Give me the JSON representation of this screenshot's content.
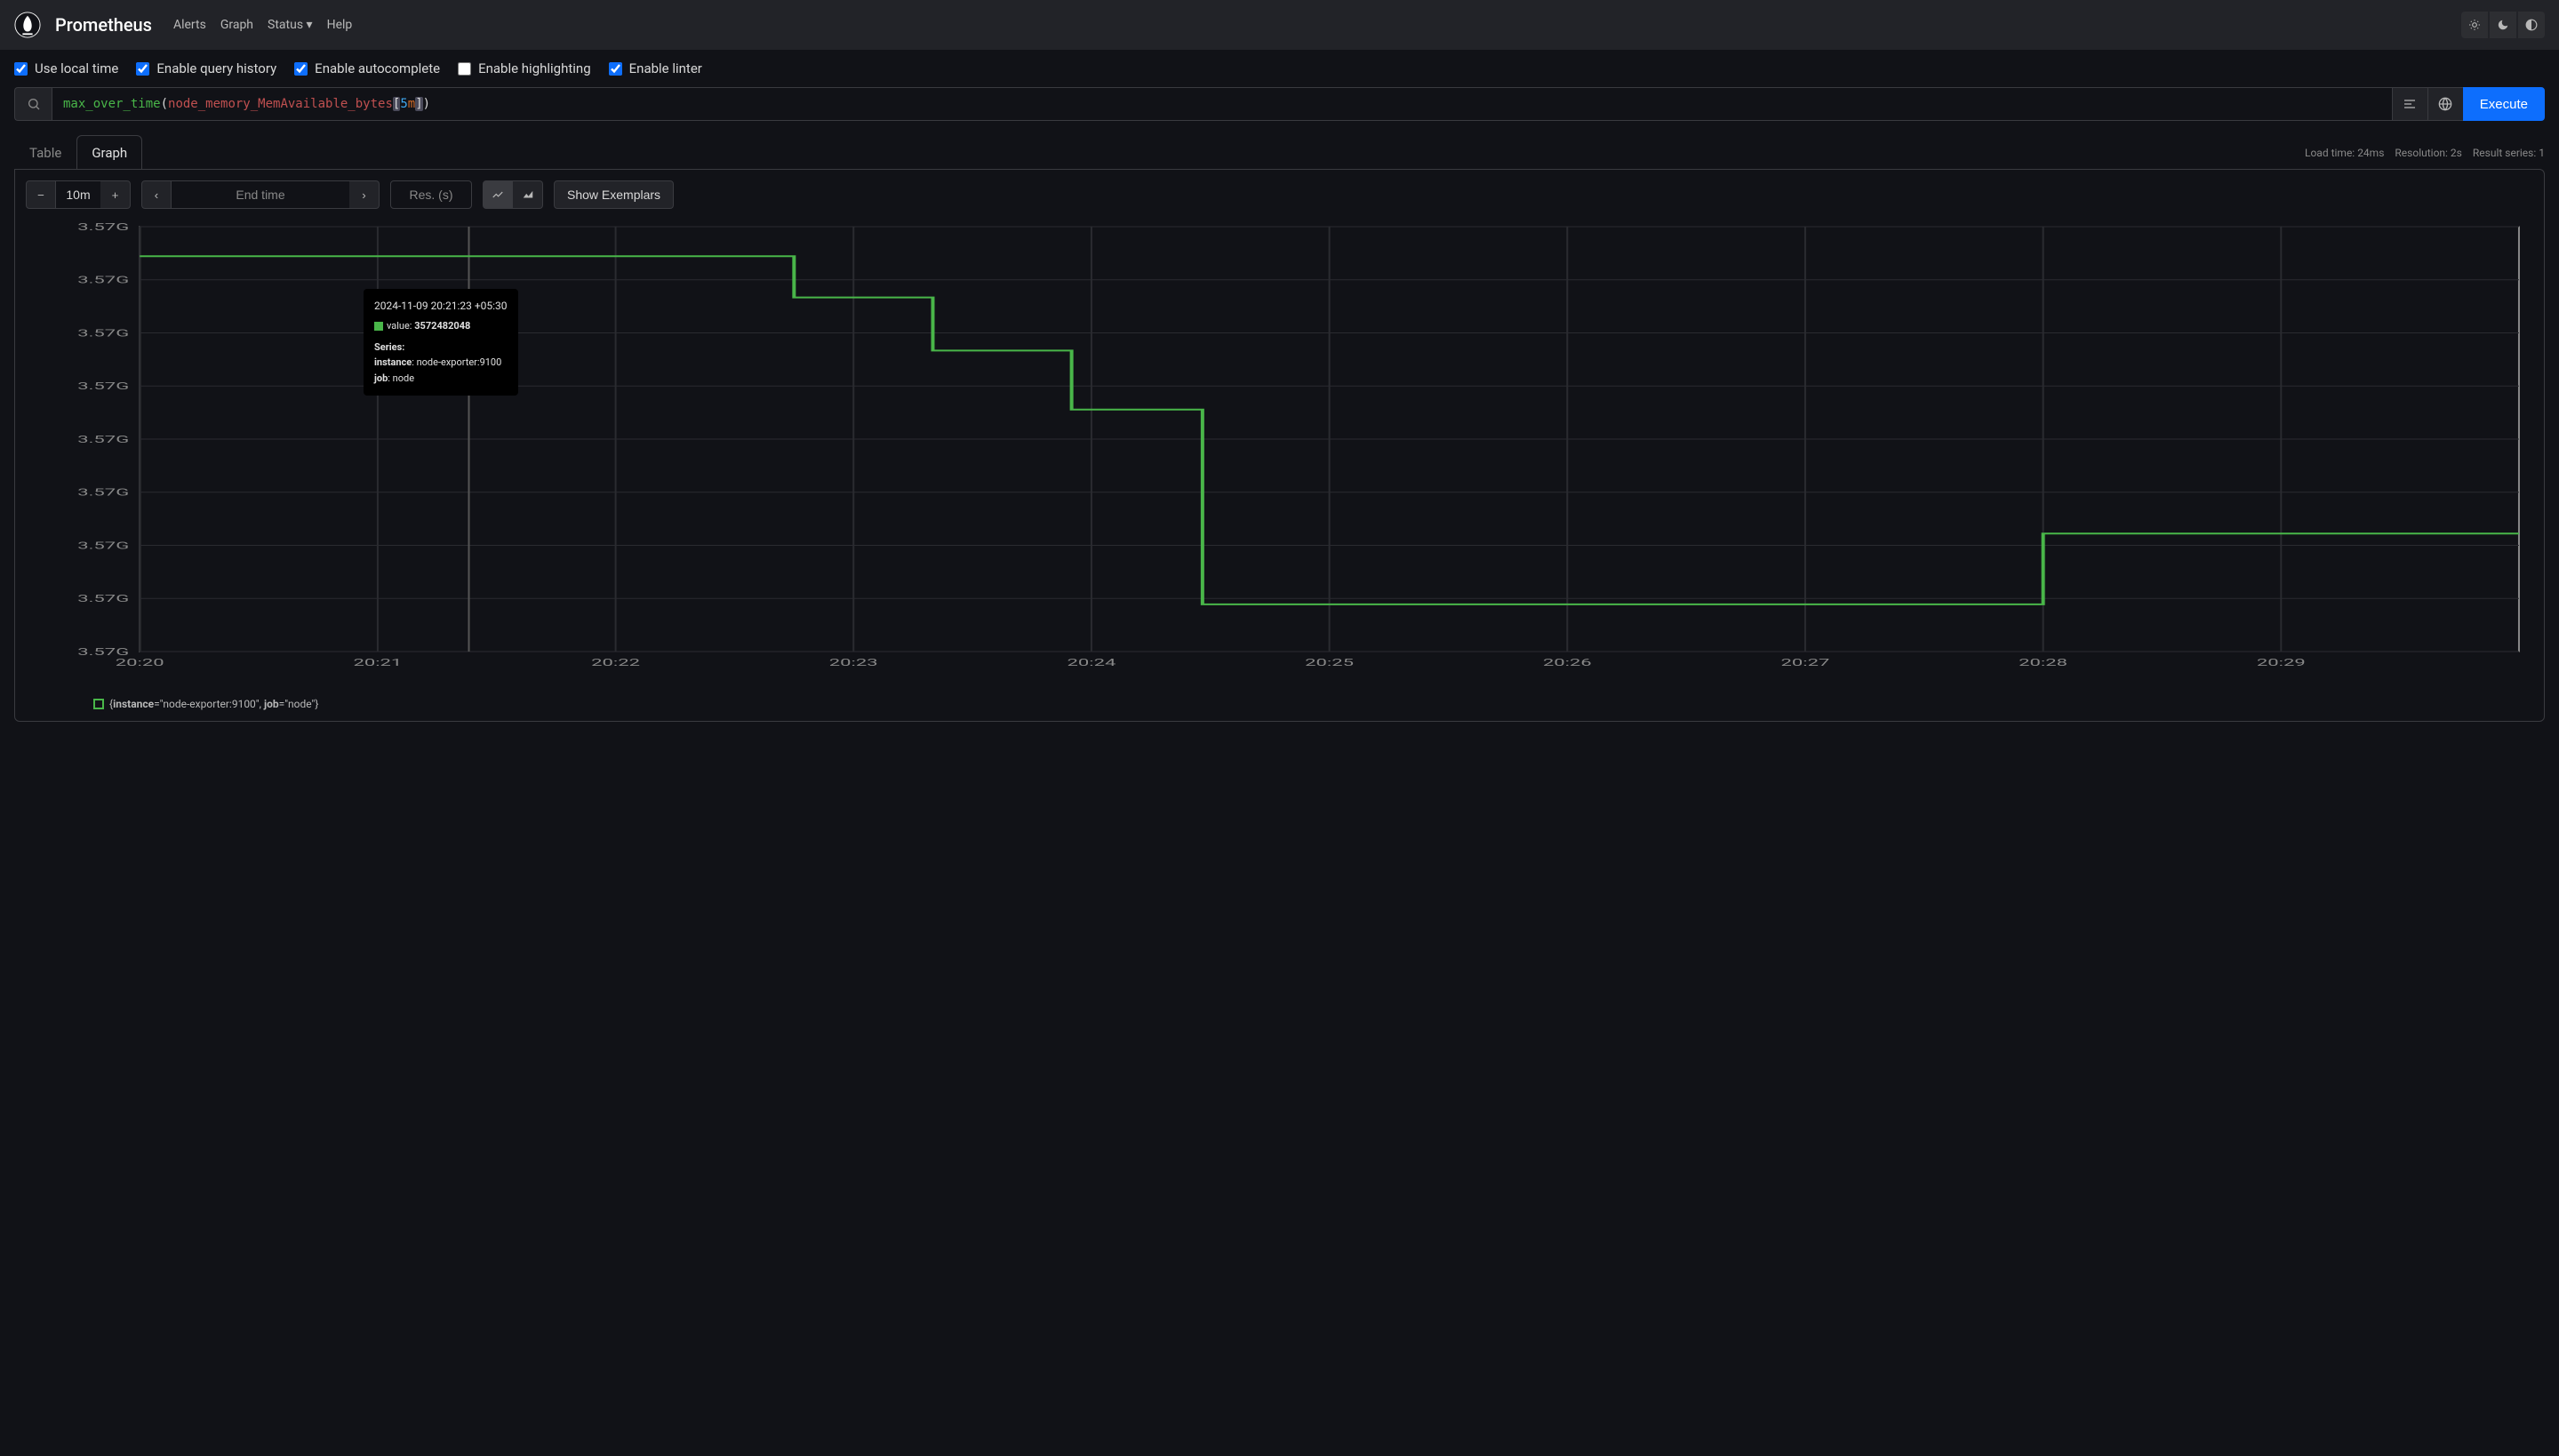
{
  "brand": "Prometheus",
  "nav": {
    "alerts": "Alerts",
    "graph": "Graph",
    "status": "Status",
    "help": "Help"
  },
  "options": {
    "local_time": "Use local time",
    "query_history": "Enable query history",
    "autocomplete": "Enable autocomplete",
    "highlighting": "Enable highlighting",
    "linter": "Enable linter"
  },
  "query": {
    "fn": "max_over_time",
    "open_paren": "(",
    "metric": "node_memory_MemAvailable_bytes",
    "open_bracket": "[",
    "range_num": "5",
    "range_unit": "m",
    "close_bracket": "]",
    "close_paren": ")",
    "execute_label": "Execute"
  },
  "tabs": {
    "table": "Table",
    "graph": "Graph"
  },
  "stats": {
    "load_time": "Load time: 24ms",
    "resolution": "Resolution: 2s",
    "result_series": "Result series: 1"
  },
  "controls": {
    "range": "10m",
    "end_time_placeholder": "End time",
    "res_placeholder": "Res. (s)",
    "show_exemplars": "Show Exemplars"
  },
  "chart_data": {
    "type": "line",
    "x": [
      "20:20",
      "20:21",
      "20:22",
      "20:23",
      "20:24",
      "20:25",
      "20:26",
      "20:27",
      "20:28",
      "20:29"
    ],
    "x_timestamps_rel": [
      0,
      60,
      120,
      180,
      240,
      300,
      360,
      420,
      480,
      540
    ],
    "series": [
      {
        "name": "{instance=\"node-exporter:9100\", job=\"node\"}",
        "color": "#49b649",
        "points_rel": [
          [
            0,
            3574500000
          ],
          [
            165,
            3574500000
          ],
          [
            165,
            3573800000
          ],
          [
            200,
            3573800000
          ],
          [
            200,
            3572900000
          ],
          [
            235,
            3572900000
          ],
          [
            235,
            3571900000
          ],
          [
            268,
            3571900000
          ],
          [
            268,
            3568600000
          ],
          [
            480,
            3568600000
          ],
          [
            480,
            3569800000
          ],
          [
            600,
            3569800000
          ]
        ]
      }
    ],
    "y_ticks": [
      "3.57G",
      "3.57G",
      "3.57G",
      "3.57G",
      "3.57G",
      "3.57G",
      "3.57G",
      "3.57G",
      "3.57G"
    ],
    "y_range": [
      3567800000,
      3575000000
    ],
    "xlabel": "",
    "ylabel": ""
  },
  "tooltip": {
    "timestamp": "2024-11-09 20:21:23 +05:30",
    "value_label": "value:",
    "value": "3572482048",
    "series_label": "Series:",
    "instance_k": "instance",
    "instance_v": ": node-exporter:9100",
    "job_k": "job",
    "job_v": ": node"
  },
  "legend": {
    "open": "{",
    "instance_k": "instance",
    "instance_v": "=\"node-exporter:9100\", ",
    "job_k": "job",
    "job_v": "=\"node\"}",
    "close": ""
  }
}
